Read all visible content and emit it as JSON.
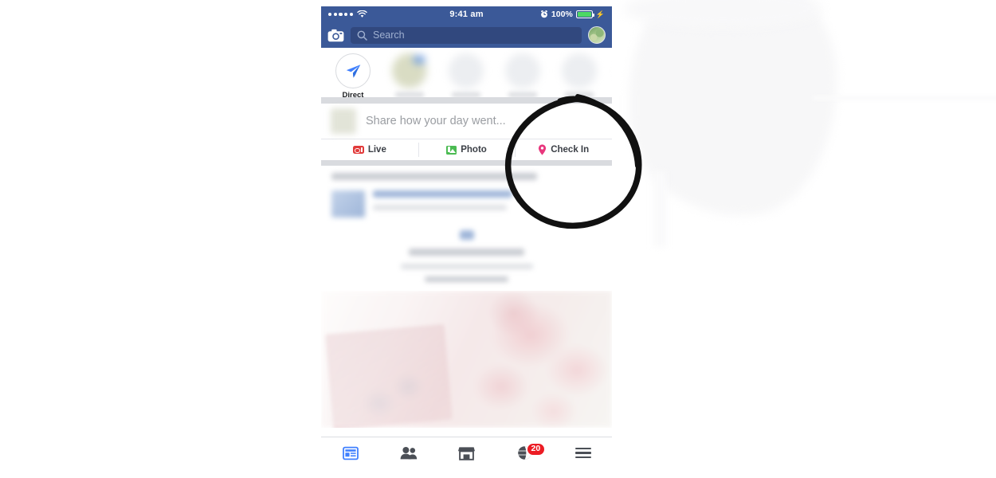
{
  "status_bar": {
    "signal_dots": 5,
    "wifi_icon": "wifi-icon",
    "time": "9:41 am",
    "alarm_icon": "alarm-clock-icon",
    "battery_percent": "100%",
    "battery_icon": "battery-full-icon",
    "charging_icon": "lightning-bolt-icon",
    "background_color": "#3b5998"
  },
  "header": {
    "camera_icon": "camera-icon",
    "search_icon": "search-icon",
    "search_placeholder": "Search",
    "search_value": "",
    "avatar": "profile-avatar",
    "background_color": "#3b5998"
  },
  "stories": {
    "items": [
      {
        "label": "Direct",
        "icon": "paper-plane-icon",
        "blurred": false
      },
      {
        "label": "",
        "icon": "",
        "blurred": true
      },
      {
        "label": "",
        "icon": "",
        "blurred": true
      },
      {
        "label": "",
        "icon": "",
        "blurred": true
      },
      {
        "label": "",
        "icon": "",
        "blurred": true
      },
      {
        "label": "",
        "icon": "",
        "blurred": true
      }
    ]
  },
  "composer": {
    "avatar": "composer-avatar",
    "placeholder": "Share how your day went...",
    "value": "",
    "actions": [
      {
        "label": "Live",
        "icon": "live-video-icon",
        "color": "#e13b3b"
      },
      {
        "label": "Photo",
        "icon": "photo-icon",
        "color": "#4bbb52"
      },
      {
        "label": "Check In",
        "icon": "location-pin-icon",
        "color": "#e8377d"
      }
    ]
  },
  "feed": {
    "suggestion_post": {
      "headline_blurred": true,
      "thumbnail_blurred": true,
      "body_blurred": true,
      "cta_blurred": true
    },
    "photo_post": {
      "image_blurred": true,
      "description": "blurred photo of roses and a framed picture"
    }
  },
  "bottom_nav": {
    "items": [
      {
        "name": "news-feed",
        "icon": "news-feed-icon",
        "active": true,
        "badge": ""
      },
      {
        "name": "friends",
        "icon": "friends-icon",
        "active": false,
        "badge": ""
      },
      {
        "name": "marketplace",
        "icon": "marketplace-icon",
        "active": false,
        "badge": ""
      },
      {
        "name": "notifications",
        "icon": "globe-notifications-icon",
        "active": false,
        "badge": "20"
      },
      {
        "name": "menu",
        "icon": "hamburger-menu-icon",
        "active": false,
        "badge": ""
      }
    ],
    "active_color": "#4080ff",
    "badge_color": "#ec1c24"
  },
  "annotation": {
    "type": "hand-drawn-circle",
    "color": "#111111",
    "target": "Check In"
  }
}
